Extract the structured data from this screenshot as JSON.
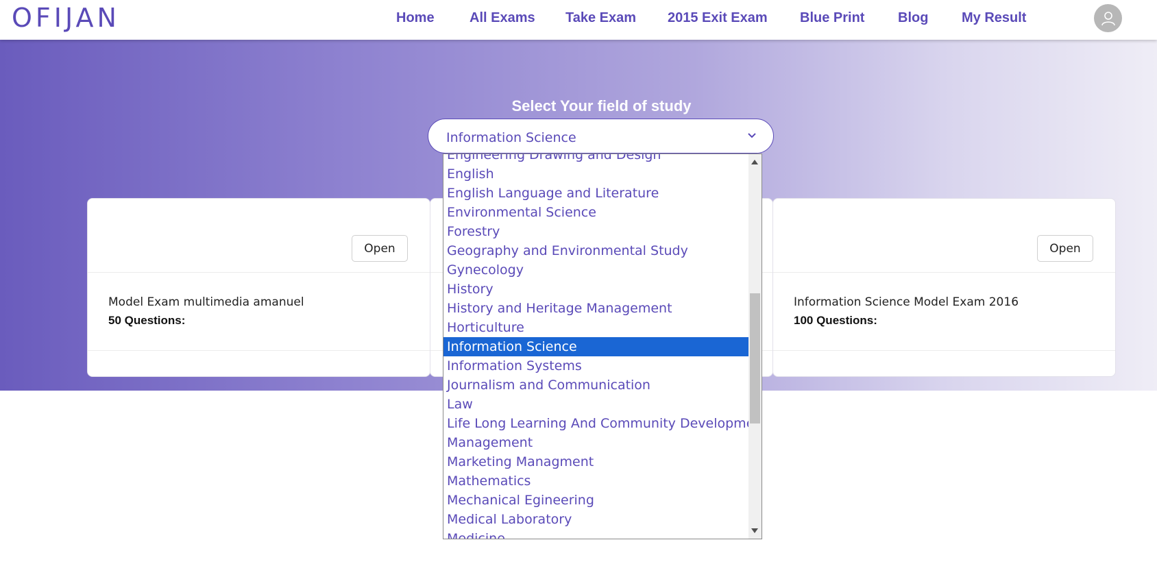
{
  "header": {
    "logo": "OFIJAN",
    "nav": [
      "Home",
      "All Exams",
      "Take Exam",
      "2015 Exit Exam",
      "Blue Print",
      "Blog",
      "My Result"
    ]
  },
  "field_select": {
    "title": "Select Your field of study",
    "selected": "Information Science"
  },
  "dropdown_options": [
    "Engineering Drawing and Design",
    "English",
    "English Language and Literature",
    "Environmental Science",
    "Forestry",
    "Geography and Environmental Study",
    "Gynecology",
    "History",
    "History and Heritage Management",
    "Horticulture",
    "Information Science",
    "Information Systems",
    "Journalism and Communication",
    "Law",
    "Life Long Learning And Community Development",
    "Management",
    "Marketing Managment",
    "Mathematics",
    "Mechanical Egineering",
    "Medical Laboratory",
    "Medicine"
  ],
  "cards": [
    {
      "button": "Open",
      "title": "Model Exam multimedia amanuel",
      "questions": "50 Questions:"
    },
    {
      "button": "Open",
      "title": "Information Science Model Exam 2016",
      "questions": "100 Questions:"
    }
  ],
  "colors": {
    "brand": "#5a4ab8",
    "selected_option": "#1a66d4"
  }
}
